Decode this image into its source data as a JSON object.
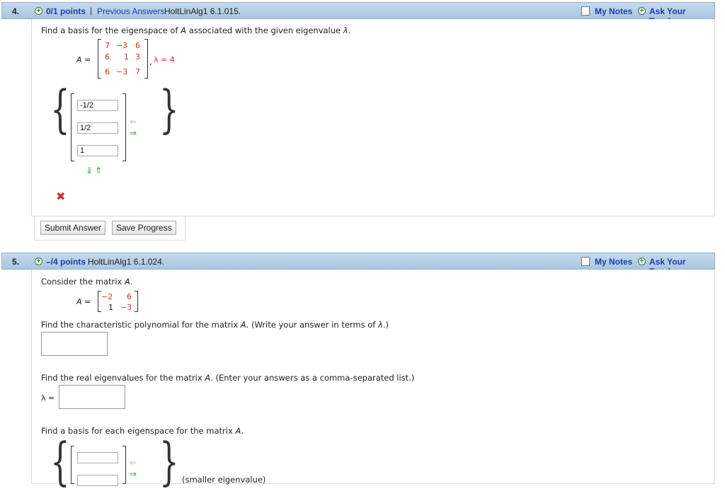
{
  "q4": {
    "number": "4.",
    "points": "0/1 points",
    "separator": "|",
    "previous_answers": "Previous Answers",
    "question_id": "HoltLinAlg1 6.1.015.",
    "my_notes": "My Notes",
    "ask_teacher": "Ask Your Teacher",
    "prompt_parts": [
      "Find a basis for the eigenspace of ",
      "A",
      " associated with the given eigenvalue ",
      "λ",
      "."
    ],
    "matrix_label": "A =",
    "matrix_rows": [
      [
        "7",
        "−3",
        "6"
      ],
      [
        "6",
        "1",
        "3"
      ],
      [
        "6",
        "−3",
        "7"
      ]
    ],
    "eigen_sep": ",",
    "eigen_eq": "λ = 4",
    "answers": [
      "-1/2",
      "1/2",
      "1"
    ],
    "submit_label": "Submit Answer",
    "save_label": "Save Progress"
  },
  "q5": {
    "number": "5.",
    "points": "–/4 points",
    "question_id": "HoltLinAlg1 6.1.024.",
    "my_notes": "My Notes",
    "ask_teacher": "Ask Your Teacher",
    "consider_parts": [
      "Consider the matrix ",
      "A",
      "."
    ],
    "matrix_label": "A =",
    "matrix_rows": [
      [
        "−2",
        "6"
      ],
      [
        "1",
        "−3"
      ]
    ],
    "char_poly_parts": [
      "Find the characteristic polynomial for the matrix ",
      "A",
      ". (Write your answer in terms of ",
      "λ",
      ".)"
    ],
    "eigenvalues_parts": [
      "Find the real eigenvalues for the matrix ",
      "A",
      ". (Enter your answers as a comma-separated list.)"
    ],
    "lambda_label": "λ =",
    "basis_parts": [
      "Find a basis for each eigenspace for the matrix ",
      "A",
      "."
    ],
    "smaller_label": "(smaller eigenvalue)"
  },
  "colors": {
    "header_bg": "#aac6e1",
    "link": "#1b3ea8",
    "error": "#d0312d",
    "arrow_green": "#2d9a2d"
  }
}
